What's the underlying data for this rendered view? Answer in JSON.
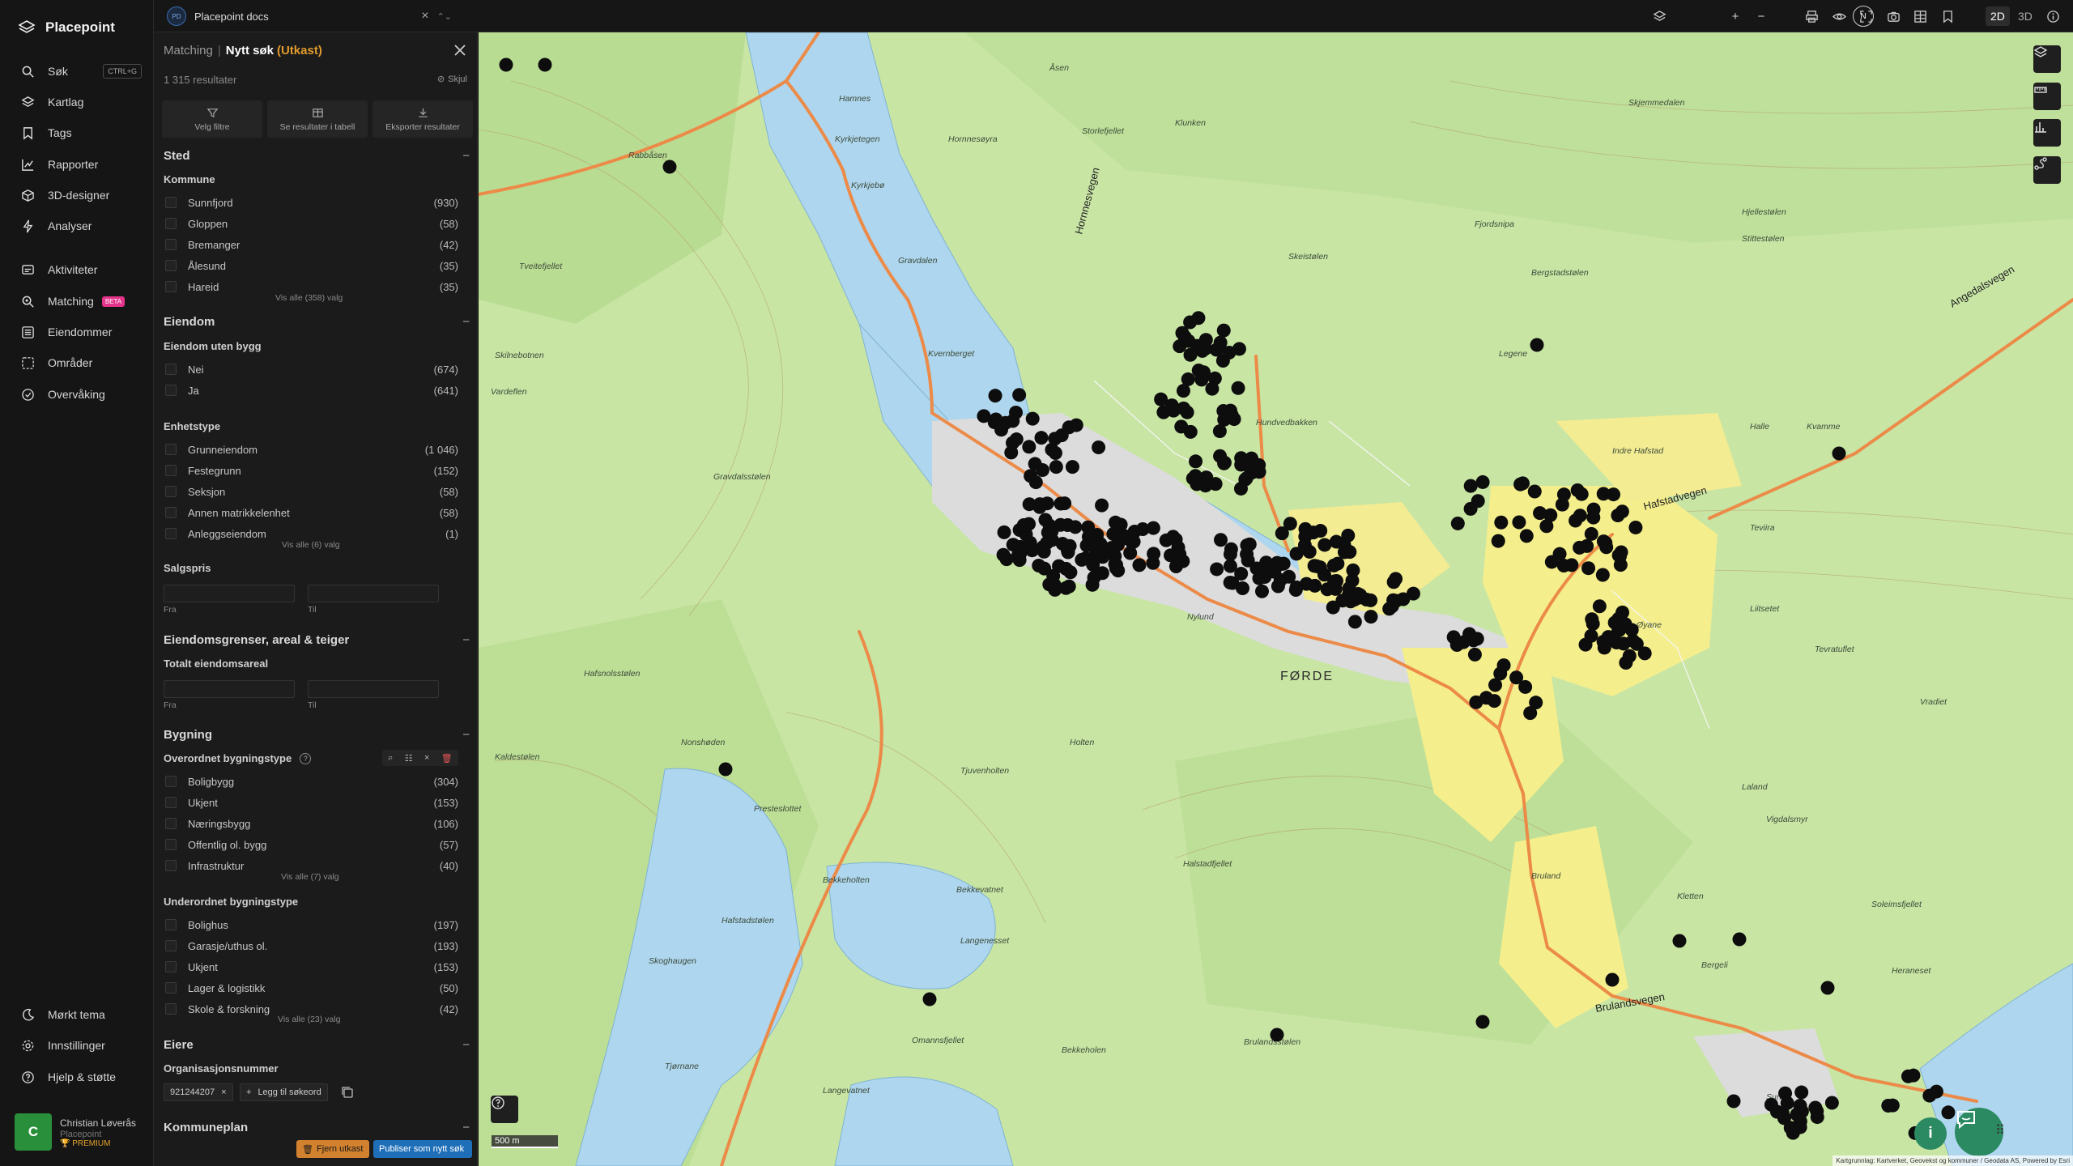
{
  "app": {
    "name": "Placepoint"
  },
  "nav": {
    "items": [
      {
        "label": "Søk",
        "shortcut": "CTRL+G"
      },
      {
        "label": "Kartlag"
      },
      {
        "label": "Tags"
      },
      {
        "label": "Rapporter"
      },
      {
        "label": "3D-designer"
      },
      {
        "label": "Analyser"
      },
      {
        "label": "Aktiviteter"
      },
      {
        "label": "Matching",
        "badge": "BETA"
      },
      {
        "label": "Eiendommer"
      },
      {
        "label": "Områder"
      },
      {
        "label": "Overvåking"
      }
    ],
    "bottom": [
      {
        "label": "Mørkt tema"
      },
      {
        "label": "Innstillinger"
      },
      {
        "label": "Hjelp & støtte"
      }
    ],
    "user": {
      "initial": "C",
      "name": "Christian Løverås",
      "company": "Placepoint",
      "plan": "PREMIUM"
    }
  },
  "topbar": {
    "workspace_badge": "PD",
    "workspace": "Placepoint docs",
    "compass": "N",
    "view_2d": "2D",
    "view_3d": "3D"
  },
  "panel": {
    "crumb_parent": "Matching",
    "crumb_current": "Nytt søk",
    "crumb_status": "(Utkast)",
    "result_count": "1 315 resultater",
    "hide_label": "Skjul",
    "actions": [
      "Velg filtre",
      "Se resultater i tabell",
      "Eksporter resultater"
    ],
    "sections": {
      "sted": "Sted",
      "eiendom": "Eiendom",
      "grenser": "Eiendomsgrenser, areal & teiger",
      "bygning": "Bygning",
      "eiere": "Eiere",
      "kommuneplan": "Kommuneplan"
    },
    "kommune": {
      "title": "Kommune",
      "items": [
        {
          "label": "Sunnfjord",
          "count": "(930)"
        },
        {
          "label": "Gloppen",
          "count": "(58)"
        },
        {
          "label": "Bremanger",
          "count": "(42)"
        },
        {
          "label": "Ålesund",
          "count": "(35)"
        },
        {
          "label": "Hareid",
          "count": "(35)"
        }
      ],
      "more": "Vis alle (358) valg"
    },
    "uten_bygg": {
      "title": "Eiendom uten bygg",
      "items": [
        {
          "label": "Nei",
          "count": "(674)"
        },
        {
          "label": "Ja",
          "count": "(641)"
        }
      ]
    },
    "enhetstype": {
      "title": "Enhetstype",
      "items": [
        {
          "label": "Grunneiendom",
          "count": "(1 046)"
        },
        {
          "label": "Festegrunn",
          "count": "(152)"
        },
        {
          "label": "Seksjon",
          "count": "(58)"
        },
        {
          "label": "Annen matrikkelenhet",
          "count": "(58)"
        },
        {
          "label": "Anleggseiendom",
          "count": "(1)"
        }
      ],
      "more": "Vis alle (6) valg"
    },
    "salgspris": {
      "title": "Salgspris",
      "from": "Fra",
      "to": "Til"
    },
    "areal": {
      "title": "Totalt eiendomsareal",
      "from": "Fra",
      "to": "Til"
    },
    "overordnet": {
      "title": "Overordnet bygningstype",
      "items": [
        {
          "label": "Boligbygg",
          "count": "(304)"
        },
        {
          "label": "Ukjent",
          "count": "(153)"
        },
        {
          "label": "Næringsbygg",
          "count": "(106)"
        },
        {
          "label": "Offentlig ol. bygg",
          "count": "(57)"
        },
        {
          "label": "Infrastruktur",
          "count": "(40)"
        }
      ],
      "more": "Vis alle (7) valg"
    },
    "underordnet": {
      "title": "Underordnet bygningstype",
      "items": [
        {
          "label": "Bolighus",
          "count": "(197)"
        },
        {
          "label": "Garasje/uthus ol.",
          "count": "(193)"
        },
        {
          "label": "Ukjent",
          "count": "(153)"
        },
        {
          "label": "Lager & logistikk",
          "count": "(50)"
        },
        {
          "label": "Skole & forskning",
          "count": "(42)"
        }
      ],
      "more": "Vis alle (23) valg"
    },
    "orgnr": {
      "title": "Organisasjonsnummer",
      "value": "921244207",
      "add": "Legg til søkeord"
    },
    "btn_remove": "Fjern utkast",
    "btn_publish": "Publiser som nytt søk"
  },
  "map": {
    "town": "FØRDE",
    "scale": "500 m",
    "attribution": "Kartgrunnlag: Kartverket, Geovekst og kommuner / Geodata AS, Powered by Esri",
    "roads": [
      "Angedalsvegen",
      "Hafstadvegen",
      "Brulandsvegen",
      "Hornnesvegen"
    ],
    "labels": [
      "Åsen",
      "Hamnes",
      "Kyrkjetegen",
      "Rabbåsen",
      "Kyrkjebø",
      "Gravdalen",
      "Hornnesøyra",
      "Storlefjellet",
      "Klunken",
      "Fjordsnipa",
      "Bergstadstølen",
      "Skjemmedalen",
      "Hjellestølen",
      "Stittestølen",
      "Skeistølen",
      "Legene",
      "Kvernberget",
      "Skilnebotnen",
      "Vardeflen",
      "Tveitefjellet",
      "Hundvedbakken",
      "Gravdalsstølen",
      "Halle",
      "Kvamme",
      "Indre Hafstad",
      "Teviira",
      "Tevratuflet",
      "Liitsetet",
      "Øyane",
      "Nylund",
      "Hafsnolsstølen",
      "Kaldestølen",
      "Nonshøden",
      "Holten",
      "Halstadfjellet",
      "Tjuvenholten",
      "Presteslottet",
      "Laland",
      "Vigdalsmyr",
      "Vradiet",
      "Bekkeholten",
      "Hafstadstølen",
      "Bekkevatnet",
      "Langenesset",
      "Skoghaugen",
      "Bruland",
      "Kletten",
      "Soleimsfjellet",
      "Bergeli",
      "Heraneset",
      "Bekkeholen",
      "Brulandsstølen",
      "Omannsfjellet",
      "Tjørnane",
      "Langevatnet",
      "Sunde"
    ]
  }
}
